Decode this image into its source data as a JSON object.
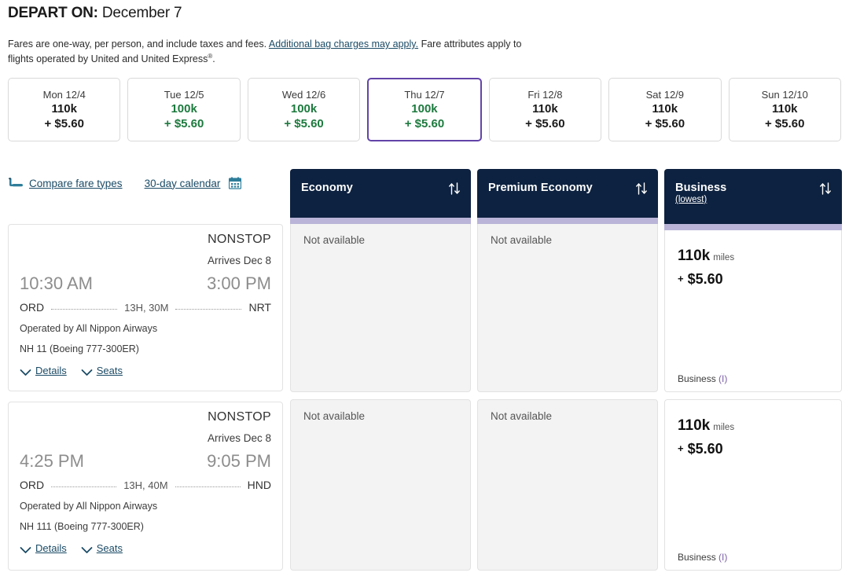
{
  "header": {
    "depart_label": "DEPART ON:",
    "depart_date": "December 7",
    "fare_note_1": "Fares are one-way, per person, and include taxes and fees. ",
    "fare_note_link": "Additional bag charges may apply.",
    "fare_note_2": " Fare attributes apply to flights operated by United and United Express",
    "fare_note_sup": "®",
    "fare_note_end": "."
  },
  "date_strip": [
    {
      "dow": "Mon 12/4",
      "miles": "110k",
      "cash": "+ $5.60",
      "lowfare": false,
      "selected": false
    },
    {
      "dow": "Tue 12/5",
      "miles": "100k",
      "cash": "+ $5.60",
      "lowfare": true,
      "selected": false
    },
    {
      "dow": "Wed 12/6",
      "miles": "100k",
      "cash": "+ $5.60",
      "lowfare": true,
      "selected": false
    },
    {
      "dow": "Thu 12/7",
      "miles": "100k",
      "cash": "+ $5.60",
      "lowfare": true,
      "selected": true
    },
    {
      "dow": "Fri 12/8",
      "miles": "110k",
      "cash": "+ $5.60",
      "lowfare": false,
      "selected": false
    },
    {
      "dow": "Sat 12/9",
      "miles": "110k",
      "cash": "+ $5.60",
      "lowfare": false,
      "selected": false
    },
    {
      "dow": "Sun 12/10",
      "miles": "110k",
      "cash": "+ $5.60",
      "lowfare": false,
      "selected": false
    }
  ],
  "links": {
    "compare_fare_types": "Compare fare types",
    "thirty_day_calendar": "30-day calendar",
    "seat_icon": "seat-icon",
    "calendar_icon": "calendar-icon"
  },
  "columns": [
    {
      "cabin": "Economy",
      "lowest": "",
      "sort_icon": "sort-icon"
    },
    {
      "cabin": "Premium Economy",
      "lowest": "",
      "sort_icon": "sort-icon"
    },
    {
      "cabin": "Business",
      "lowest": "(lowest)",
      "sort_icon": "sort-icon"
    }
  ],
  "flights": [
    {
      "nonstop": "NONSTOP",
      "arrives": "Arrives Dec 8",
      "depart_time": "10:30 AM",
      "arrive_time": "3:00 PM",
      "origin": "ORD",
      "destination": "NRT",
      "duration": "13H, 30M",
      "operated_by": "Operated by All Nippon Airways",
      "equipment": "NH 11 (Boeing 777-300ER)",
      "details_label": "Details",
      "seats_label": "Seats",
      "fares": {
        "economy": {
          "available": false,
          "na_text": "Not available"
        },
        "premium_economy": {
          "available": false,
          "na_text": "Not available"
        },
        "business": {
          "available": true,
          "miles": "110k",
          "unit": "miles",
          "plus": "+",
          "cash": "$5.60",
          "class_label": "Business ",
          "booking_code": "(I)"
        }
      }
    },
    {
      "nonstop": "NONSTOP",
      "arrives": "Arrives Dec 8",
      "depart_time": "4:25 PM",
      "arrive_time": "9:05 PM",
      "origin": "ORD",
      "destination": "HND",
      "duration": "13H, 40M",
      "operated_by": "Operated by All Nippon Airways",
      "equipment": "NH 111 (Boeing 777-300ER)",
      "details_label": "Details",
      "seats_label": "Seats",
      "fares": {
        "economy": {
          "available": false,
          "na_text": "Not available"
        },
        "premium_economy": {
          "available": false,
          "na_text": "Not available"
        },
        "business": {
          "available": true,
          "miles": "110k",
          "unit": "miles",
          "plus": "+",
          "cash": "$5.60",
          "class_label": "Business ",
          "booking_code": "(I)"
        }
      }
    }
  ],
  "colors": {
    "header_navy": "#0d2240",
    "accent_purple": "#6244a8",
    "underbar_lavender": "#b9b4d8",
    "low_fare_green": "#1d7a3e",
    "link_teal": "#1b4b66"
  }
}
